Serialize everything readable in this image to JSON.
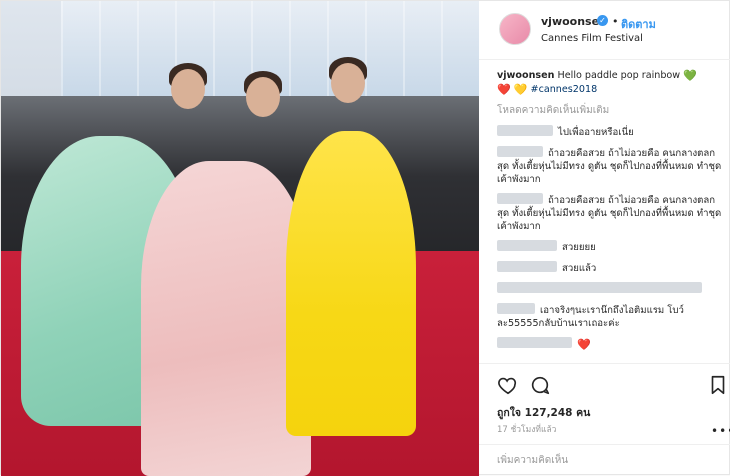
{
  "post": {
    "username": "vjwoonsen",
    "follow_label": "ติดตาม",
    "separator": "•",
    "location": "Cannes Film Festival",
    "verified_mark": "✓"
  },
  "caption": {
    "username": "vjwoonsen",
    "text": "Hello paddle pop rainbow",
    "emoji_green": "💚",
    "emoji_red": "❤️",
    "emoji_yellow": "💛",
    "hashtag": "#cannes2018"
  },
  "load_more_label": "โหลดความคิดเห็นเพิ่มเติม",
  "comments": [
    "ไปเพื่ออายหรือเนี่ย",
    "ถ้าอวยคือสวย ถ้าไม่อวยคือ คนกลางตลกสุด ทั้งเตี้ยหุ่นไม่มีทรง ดูตัน ชุดก็ไปกองที่พื้นหมด ทำชุดเค้าพังมาก",
    "ถ้าอวยคือสวย ถ้าไม่อวยคือ คนกลางตลกสุด ทั้งเตี้ยหุ่นไม่มีทรง ดูตัน ชุดก็ไปกองที่พื้นหมด ทำชุดเค้าพังมาก",
    "สวยยยย",
    "สวยแล้ว",
    "",
    "เอาจริงๆนะเราน๊กถึงไอติมแรม โบว์ละ55555กลับบ้านเราเถอะค่ะ"
  ],
  "comment_heart": "❤️",
  "likes_label": "ถูกใจ 127,248 คน",
  "time_label": "17 ชั่วโมงที่แล้ว",
  "more_label": "•••",
  "add_comment_placeholder": "เพิ่มความคิดเห็น",
  "icons": [
    "heart-outline-icon",
    "comment-icon",
    "bookmark-icon",
    "verified-icon",
    "ellipsis-icon"
  ],
  "colors": {
    "accent": "#3897f0",
    "hashtag": "#003569",
    "muted": "#999999"
  }
}
